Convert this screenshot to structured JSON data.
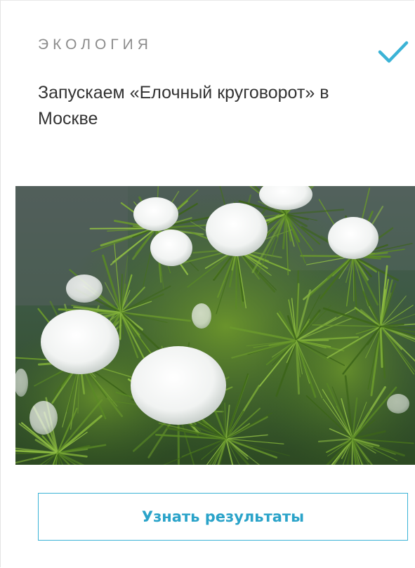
{
  "card": {
    "category": "ЭКОЛОГИЯ",
    "title": "Запускаем «Елочный круговорот» в Москве",
    "check_icon": "checkmark-icon",
    "image_icon": "snowy-pine-branches-photo",
    "button_label": "Узнать результаты"
  },
  "colors": {
    "accent": "#3bb3d6",
    "category_text": "#8c8c8c",
    "title_text": "#333333"
  }
}
